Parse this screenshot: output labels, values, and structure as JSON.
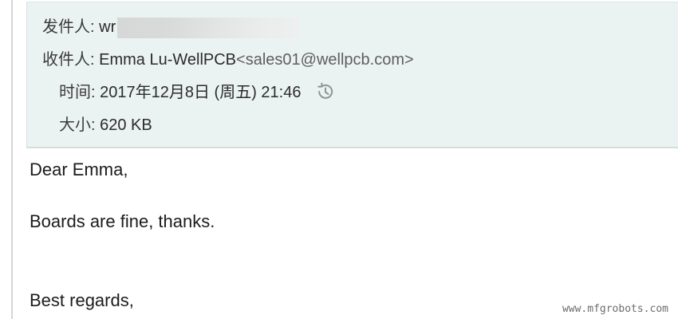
{
  "header": {
    "from_label": "发件人:",
    "from_value": "wr",
    "to_label": "收件人:",
    "to_name": "Emma Lu-WellPCB",
    "to_email": "<sales01@wellpcb.com>",
    "time_label": "时间:",
    "time_value": "2017年12月8日 (周五) 21:46",
    "size_label": "大小:",
    "size_value": "620 KB"
  },
  "body": {
    "greeting": "Dear Emma,",
    "message": "Boards are fine, thanks.",
    "closing": "Best regards,"
  },
  "watermark": "www.mfgrobots.com",
  "icons": {
    "time_icon": "history-icon"
  },
  "colors": {
    "header_bg": "#ebf3f2",
    "text": "#2b2b2b",
    "email": "#5e5e5e"
  }
}
